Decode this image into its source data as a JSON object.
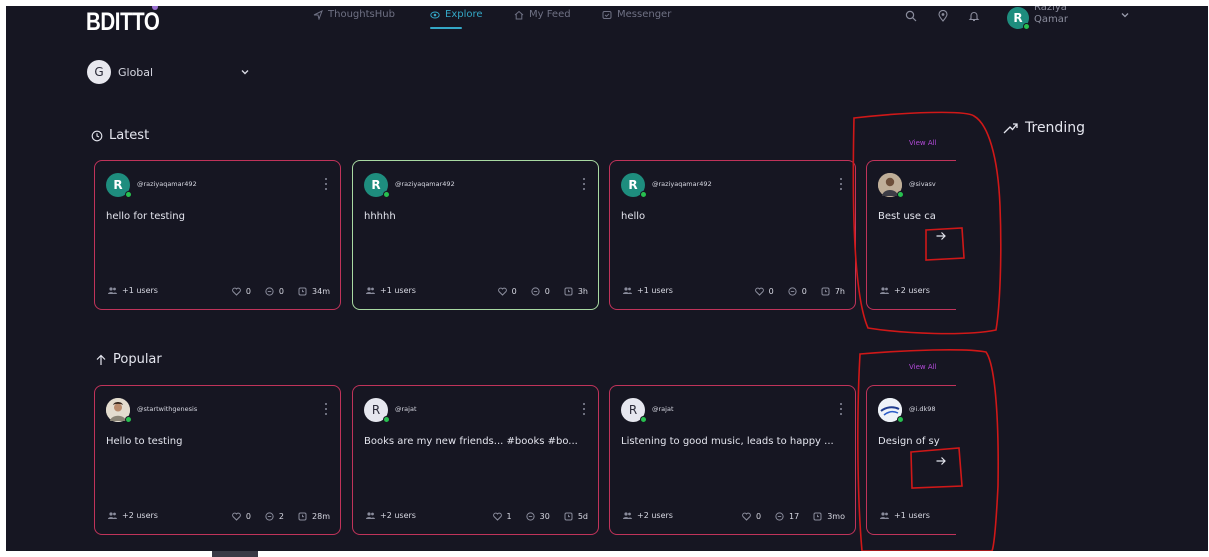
{
  "header": {
    "logo": "BDITTO",
    "nav": [
      {
        "label": "ThoughtsHub",
        "icon": "send-icon"
      },
      {
        "label": "Explore",
        "icon": "eye-icon",
        "active": true
      },
      {
        "label": "My Feed",
        "icon": "home-icon"
      },
      {
        "label": "Messenger",
        "icon": "message-icon"
      }
    ],
    "icons": [
      "search-icon",
      "location-icon",
      "bell-icon"
    ],
    "user": {
      "initial": "R",
      "name_line1": "Raziya",
      "name_line2": "Qamar"
    }
  },
  "scope": {
    "initial": "G",
    "label": "Global"
  },
  "sections": {
    "latest": {
      "title": "Latest",
      "view_all": "View All",
      "cards": [
        {
          "avatar": "R",
          "handle": "@raziyaqamar492",
          "text": "hello for testing",
          "users": "+1 users",
          "likes": "0",
          "comments": "0",
          "time": "34m"
        },
        {
          "avatar": "R",
          "handle": "@raziyaqamar492",
          "text": "hhhhh",
          "users": "+1 users",
          "likes": "0",
          "comments": "0",
          "time": "3h"
        },
        {
          "avatar": "R",
          "handle": "@raziyaqamar492",
          "text": "hello",
          "users": "+1 users",
          "likes": "0",
          "comments": "0",
          "time": "7h"
        },
        {
          "avatar": "photo",
          "handle": "@sivasv",
          "text": "Best use ca",
          "users": "+2 users"
        }
      ]
    },
    "popular": {
      "title": "Popular",
      "view_all": "View All",
      "cards": [
        {
          "avatar": "photo",
          "handle": "@startwithgenesis",
          "text": "Hello to testing",
          "users": "+2 users",
          "likes": "0",
          "comments": "2",
          "time": "28m"
        },
        {
          "avatar": "R",
          "handle": "@rajat",
          "text": "Books are my new friends... #books #bo...",
          "users": "+2 users",
          "likes": "1",
          "comments": "30",
          "time": "5d"
        },
        {
          "avatar": "R",
          "handle": "@rajat",
          "text": "Listening to good music, leads to happy ...",
          "users": "+2 users",
          "likes": "0",
          "comments": "17",
          "time": "3mo"
        },
        {
          "avatar": "photo",
          "handle": "@i.dk98",
          "text": "Design of sy",
          "users": "+1 users"
        }
      ]
    }
  },
  "trending": {
    "title": "Trending"
  },
  "colors": {
    "background": "#161622",
    "card_border": "#c0335a",
    "card_border_active": "#a8d9a2",
    "accent": "#34a7c6",
    "view_all": "#b24ad8",
    "online": "#27c04f",
    "annotation": "#d01818"
  }
}
